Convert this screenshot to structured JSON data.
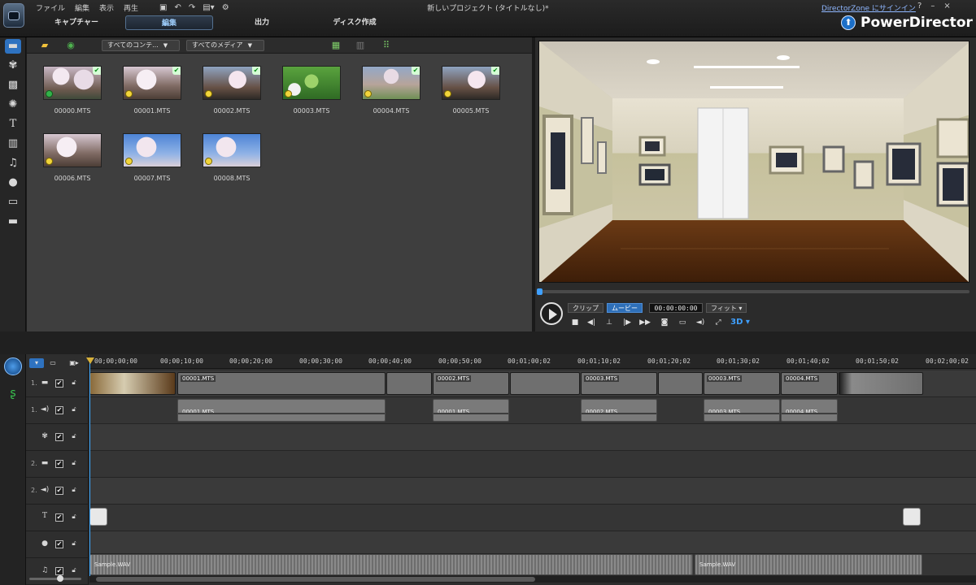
{
  "topbar": {
    "menu": [
      "ファイル",
      "編集",
      "表示",
      "再生"
    ],
    "quick_icons": [
      "save-icon",
      "undo-icon",
      "redo-icon",
      "capture-menu-icon",
      "gear-icon"
    ],
    "title": "新しいプロジェクト (タイトルなし)*",
    "directorzone": "DirectorZone にサインイン",
    "win_help": "?",
    "win_min": "–",
    "win_close": "×",
    "modes": [
      "キャプチャー",
      "編集",
      "出力",
      "ディスク作成"
    ],
    "active_mode": 1,
    "brand": "PowerDirector"
  },
  "library": {
    "filter_content": "すべてのコンテ...",
    "filter_media": "すべてのメディア",
    "clips": [
      {
        "name": "00000.MTS",
        "checked": true,
        "badge": "green"
      },
      {
        "name": "00001.MTS",
        "checked": true,
        "badge": "yellow"
      },
      {
        "name": "00002.MTS",
        "checked": true,
        "badge": "yellow"
      },
      {
        "name": "00003.MTS",
        "checked": false,
        "badge": "yellow"
      },
      {
        "name": "00004.MTS",
        "checked": true,
        "badge": "yellow"
      },
      {
        "name": "00005.MTS",
        "checked": true,
        "badge": "yellow"
      },
      {
        "name": "00006.MTS",
        "checked": false,
        "badge": "yellow"
      },
      {
        "name": "00007.MTS",
        "checked": false,
        "badge": "yellow"
      },
      {
        "name": "00008.MTS",
        "checked": false,
        "badge": "yellow"
      }
    ]
  },
  "preview": {
    "clip_label": "クリップ",
    "movie_label": "ムービー",
    "timecode": "00:00:00:00",
    "fit_label": "フィット",
    "mode_3d": "3D",
    "seek_position": 0.0
  },
  "timeline": {
    "ruler": [
      "00;00;00;00",
      "00;00;10;00",
      "00;00;20;00",
      "00;00;30;00",
      "00;00;40;00",
      "00;00;50;00",
      "00;01;00;02",
      "00;01;10;02",
      "00;01;20;02",
      "00;01;30;02",
      "00;01;40;02",
      "00;01;50;02",
      "00;02;00;02"
    ],
    "tracks": [
      {
        "num": "1.",
        "type": "video",
        "icon": "video-track-icon"
      },
      {
        "num": "1.",
        "type": "audio",
        "icon": "audio-track-icon"
      },
      {
        "num": "",
        "type": "effect",
        "icon": "effect-track-icon"
      },
      {
        "num": "2.",
        "type": "video",
        "icon": "video-track-icon"
      },
      {
        "num": "2.",
        "type": "audio",
        "icon": "audio-track-icon"
      },
      {
        "num": "",
        "type": "title",
        "icon": "title-track-icon"
      },
      {
        "num": "",
        "type": "voice",
        "icon": "voice-track-icon"
      },
      {
        "num": "",
        "type": "music",
        "icon": "music-track-icon"
      }
    ],
    "video_clips": [
      {
        "label": "",
        "style": "room"
      },
      {
        "label": "00001.MTS",
        "style": "sakura2"
      },
      {
        "label": "",
        "style": "sakura1"
      },
      {
        "label": "00002.MTS",
        "style": "sakura1"
      },
      {
        "label": "",
        "style": "sakura5"
      },
      {
        "label": "00003.MTS",
        "style": "sakura1"
      },
      {
        "label": "",
        "style": "sakura2"
      },
      {
        "label": "00003.MTS",
        "style": "sakura3"
      },
      {
        "label": "00004.MTS",
        "style": "sakura5"
      },
      {
        "label": "",
        "style": "room"
      }
    ],
    "audio_clips": [
      "00001.MTS",
      "00001.MTS",
      "00002.MTS",
      "00003.MTS",
      "00004.MTS"
    ],
    "music_clips": [
      "Sample.WAV",
      "Sample.WAV"
    ]
  }
}
